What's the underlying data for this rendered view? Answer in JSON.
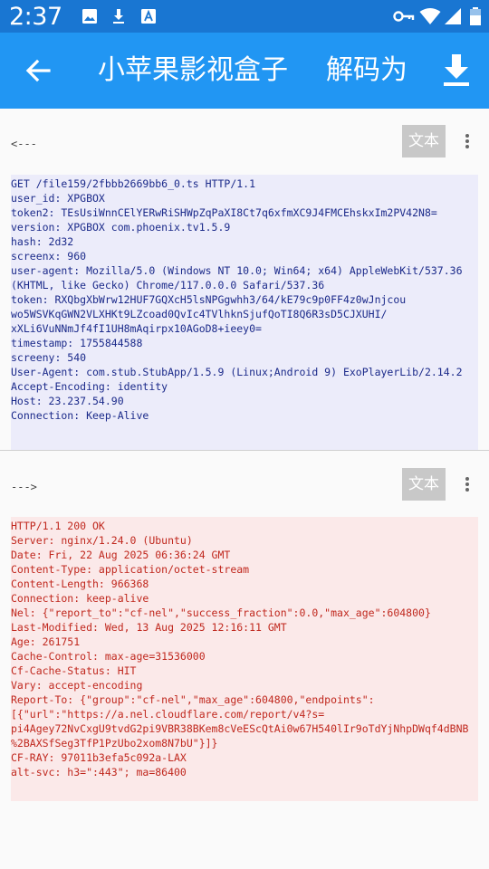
{
  "status_bar": {
    "time": "2:37",
    "notification_icons": [
      "image-icon",
      "download-icon",
      "font-icon"
    ],
    "system_icons": [
      "vpn-key-icon",
      "wifi-icon",
      "signal-icon",
      "battery-icon"
    ]
  },
  "app_bar": {
    "title": "小苹果影视盒子",
    "action_label": "解码为",
    "color": "#2196f3",
    "status_color": "#1976d2"
  },
  "request": {
    "label": "<---",
    "text_button": "文本",
    "lines": [
      "GET /file159/2fbbb2669bb6_0.ts HTTP/1.1",
      "user_id: XPGBOX",
      "token2: TEsUsiWnnCElYERwRiSHWpZqPaXI8Ct7q6xfmXC9J4FMCEhskxIm2PV42N8=",
      "version: XPGBOX com.phoenix.tv1.5.9",
      "hash: 2d32",
      "screenx: 960",
      "user-agent: Mozilla/5.0 (Windows NT 10.0; Win64; x64) AppleWebKit/537.36",
      "(KHTML, like Gecko) Chrome/117.0.0.0 Safari/537.36",
      "token: RXQbgXbWrw12HUF7GQXcH5lsNPGgwhh3/64/kE79c9p0FF4z0wJnjcou",
      "wo5WSVKqGWN2VLXHKt9LZcoad0QvIc4TVlhknSjufQoTI8Q6R3sD5CJXUHI/",
      "xXLi6VuNNmJf4fI1UH8mAqirpx10AGoD8+ieey0=",
      "timestamp: 1755844588",
      "screeny: 540",
      "User-Agent: com.stub.StubApp/1.5.9 (Linux;Android 9) ExoPlayerLib/2.14.2",
      "Accept-Encoding: identity",
      "Host: 23.237.54.90",
      "Connection: Keep-Alive"
    ]
  },
  "response": {
    "label": "--->",
    "text_button": "文本",
    "lines": [
      "HTTP/1.1 200 OK",
      "Server: nginx/1.24.0 (Ubuntu)",
      "Date: Fri, 22 Aug 2025 06:36:24 GMT",
      "Content-Type: application/octet-stream",
      "Content-Length: 966368",
      "Connection: keep-alive",
      "Nel: {\"report_to\":\"cf-nel\",\"success_fraction\":0.0,\"max_age\":604800}",
      "Last-Modified: Wed, 13 Aug 2025 12:16:11 GMT",
      "Age: 261751",
      "Cache-Control: max-age=31536000",
      "Cf-Cache-Status: HIT",
      "Vary: accept-encoding",
      "Report-To: {\"group\":\"cf-nel\",\"max_age\":604800,\"endpoints\":",
      "[{\"url\":\"https://a.nel.cloudflare.com/report/v4?s=",
      "pi4Agey72NvCxgU9tvdG2pi9VBR38BKem8cVeEScQtAi0w67H540lIr9oTdYjNhpDWqf4dBNB",
      "%2BAXSfSeg3TfP1PzUbo2xom8N7bU\"}]}",
      "CF-RAY: 97011b3efa5c092a-LAX",
      "alt-svc: h3=\":443\"; ma=86400"
    ]
  }
}
